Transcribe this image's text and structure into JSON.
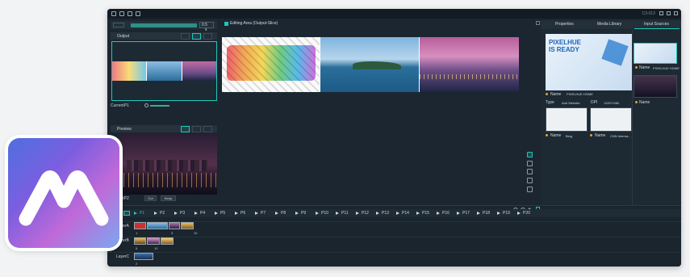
{
  "window": {
    "title": "C3-012"
  },
  "left": {
    "duration_value": "0.5",
    "duration_unit": "s",
    "output_label": "Output",
    "current_label": "CurrentP1",
    "preview_label": "Preview",
    "preview_current_label": "CurrentP2",
    "cut_label": "Cut",
    "keep_label": "Keep"
  },
  "editing": {
    "title": "Editing Area (Output-Slice)"
  },
  "right": {
    "tabs": [
      "Properties",
      "Media Library",
      "Input Sources"
    ],
    "preview_headline_1": "PIXELHUE",
    "preview_headline_2": "IS READY",
    "name_label": "Name",
    "name_value": "PIXELHUE HOME",
    "type_label": "Type",
    "type_value": "Add Website",
    "dpi_label": "DPI",
    "dpi_value": "1920*1080",
    "thumbs": [
      {
        "label": "Name",
        "value": "Bing"
      },
      {
        "label": "Name",
        "value": "CNN Interna..."
      }
    ],
    "source_name_label": "Name",
    "source_name_value": "PIXELHUE HOME",
    "source_name2_label": "Name"
  },
  "timeline": {
    "presets": [
      "P1",
      "P2",
      "P3",
      "P4",
      "P5",
      "P6",
      "P7",
      "P8",
      "P9",
      "P10",
      "P11",
      "P12",
      "P13",
      "P14",
      "P15",
      "P16",
      "P17",
      "P18",
      "P19",
      "P20"
    ],
    "layers": [
      "LayerA",
      "LayerB",
      "LayerC"
    ],
    "clip_numbers_a": [
      "1",
      "3",
      "10"
    ],
    "clip_numbers_b": [
      "5",
      "10"
    ],
    "clip_numbers_c": [
      "2"
    ]
  },
  "colors": {
    "accent": "#1ec8b8",
    "app_bg": "#1b2630"
  }
}
